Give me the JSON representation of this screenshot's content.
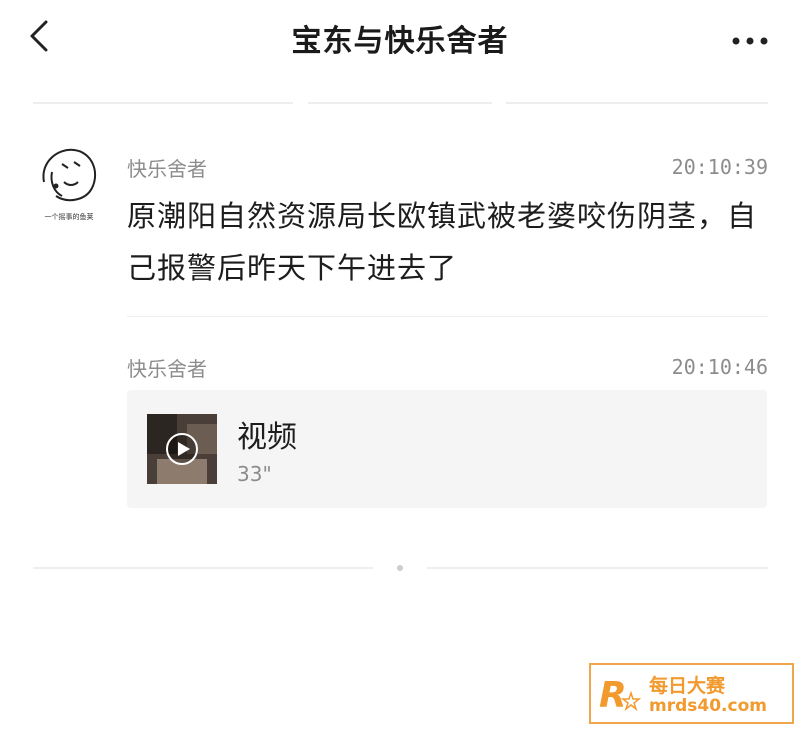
{
  "header": {
    "title": "宝东与快乐舍者"
  },
  "avatar": {
    "caption": "一个摇事的鱼荚"
  },
  "messages": [
    {
      "sender": "快乐舍者",
      "time": "20:10:39",
      "text": "原潮阳自然资源局长欧镇武被老婆咬伤阴茎，自己报警后昨天下午进去了"
    },
    {
      "sender": "快乐舍者",
      "time": "20:10:46",
      "video": {
        "label": "视频",
        "duration": "33\""
      }
    }
  ],
  "watermark": {
    "name": "每日大赛",
    "url": "mrds40.com",
    "color": "#f29a2e"
  }
}
